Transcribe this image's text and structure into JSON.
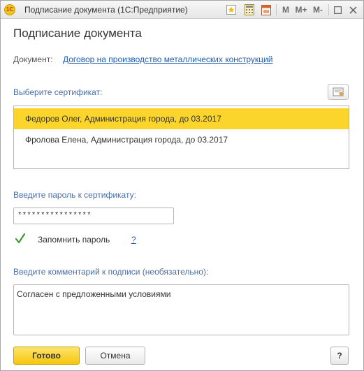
{
  "window": {
    "app_logo": "1С",
    "title": "Подписание документа  (1С:Предприятие)",
    "toolbar": {
      "memory_m": "M",
      "memory_plus": "M+",
      "memory_minus": "M-"
    }
  },
  "heading": "Подписание документа",
  "document": {
    "label": "Документ:",
    "link": "Договор на производство металлических конструкций"
  },
  "certificates": {
    "label": "Выберите сертификат:",
    "items": [
      {
        "text": "Федоров Олег, Администрация города, до 03.2017",
        "selected": true
      },
      {
        "text": "Фролова Елена, Администрация города, до 03.2017",
        "selected": false
      }
    ]
  },
  "password": {
    "label": "Введите пароль к сертификату:",
    "value": "****************",
    "remember_label": "Запомнить пароль",
    "remember_checked": true,
    "help": "?"
  },
  "comment": {
    "label": "Введите комментарий к подписи (необязательно):",
    "value": "Согласен с предложенными условиями"
  },
  "buttons": {
    "ok": "Готово",
    "cancel": "Отмена",
    "help": "?"
  },
  "colors": {
    "accent": "#fbd52b",
    "link": "#1f5fb3",
    "label": "#4a6ea8",
    "check": "#3a9a2a"
  }
}
